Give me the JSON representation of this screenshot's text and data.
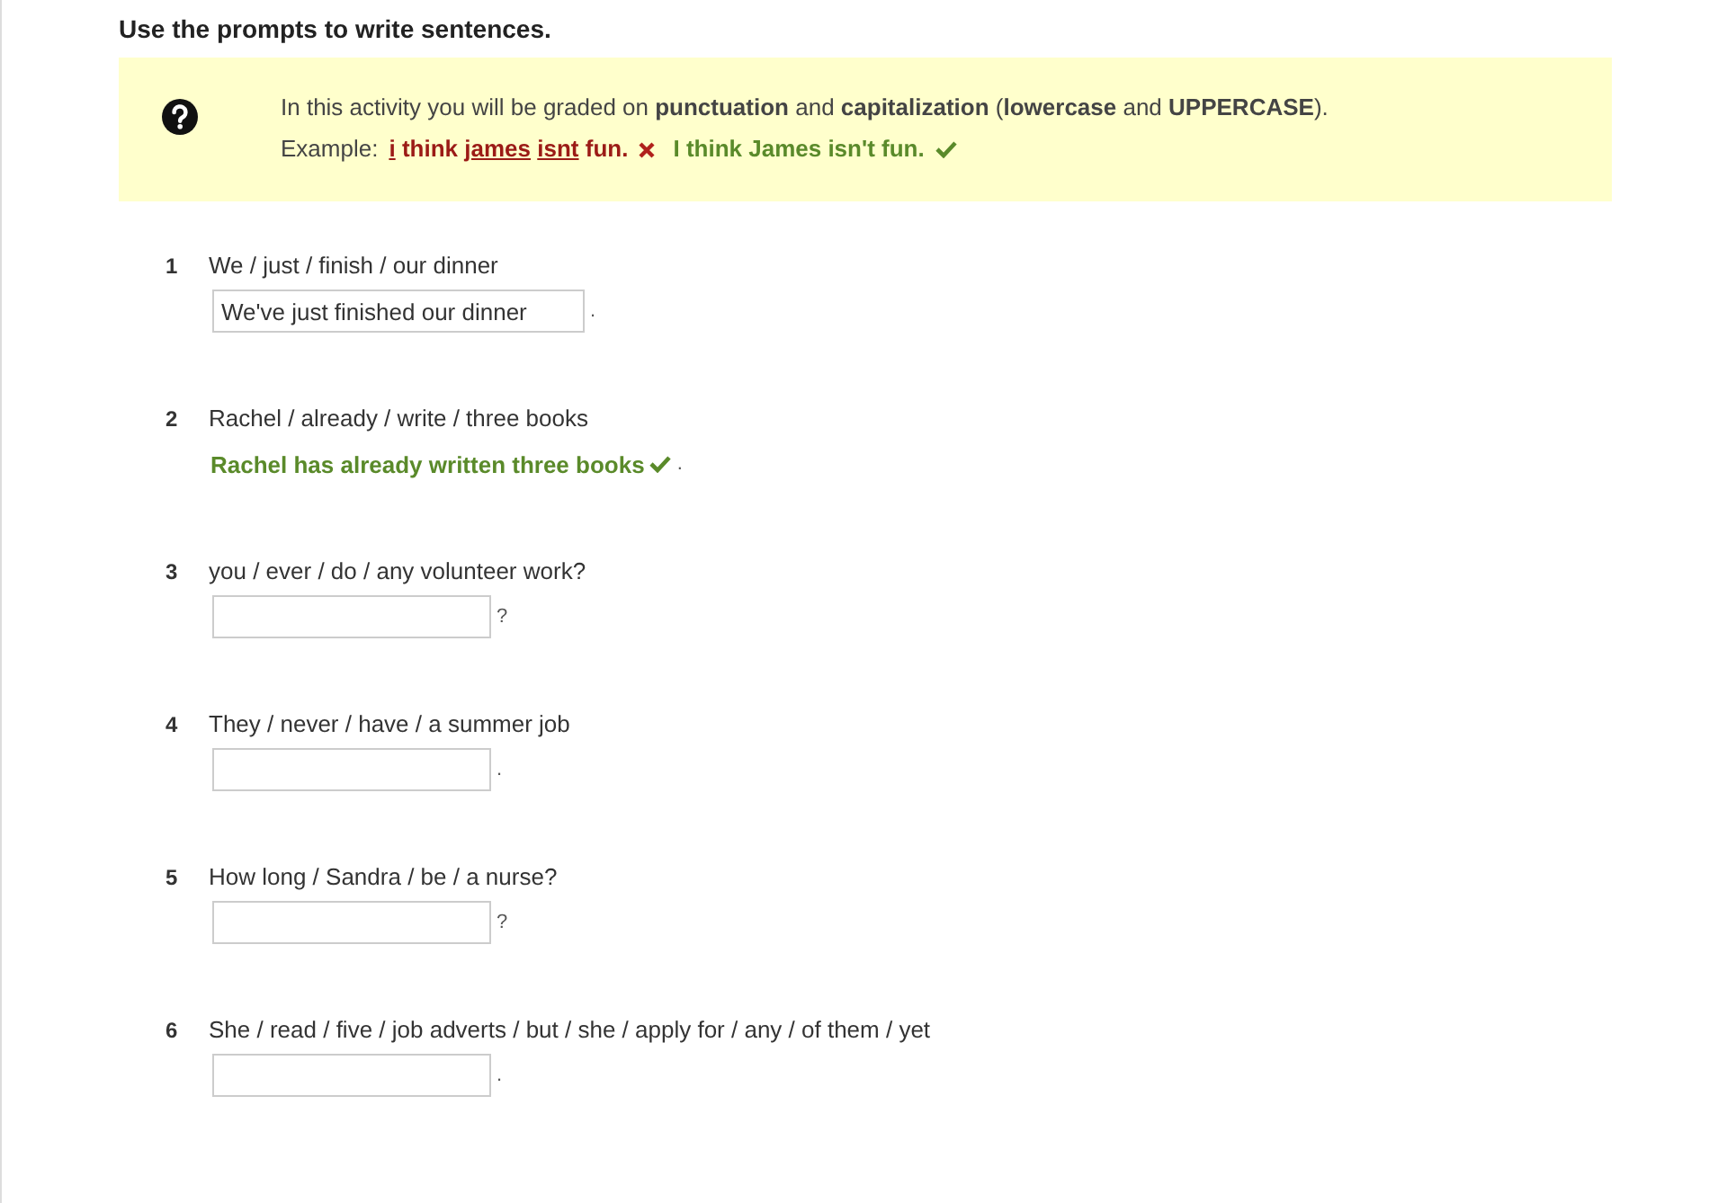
{
  "title": "Use the prompts to write sentences.",
  "info": {
    "text": "In this activity you will be graded on **punctuation** and **capitalization** (**lowercase** and **UPPERCASE**).",
    "example_label": "Example:",
    "wrong": [
      {
        "text": "i",
        "error": true
      },
      {
        "text": "think",
        "error": false
      },
      {
        "text": "james",
        "error": true
      },
      {
        "text": "isnt",
        "error": true
      },
      {
        "text": "fun.",
        "error": false
      }
    ],
    "right": "I think James isn't fun."
  },
  "items": [
    {
      "number": "1",
      "prompt": "We / just / finish / our dinner",
      "kind": "input",
      "value": "We've just finished our dinner",
      "end": "."
    },
    {
      "number": "2",
      "prompt": "Rachel / already / write / three books",
      "kind": "answered",
      "answer": "Rachel has already written three books",
      "correct": true,
      "end": "."
    },
    {
      "number": "3",
      "prompt": "you / ever / do / any volunteer work?",
      "kind": "input",
      "end": "?"
    },
    {
      "number": "4",
      "prompt": "They / never / have / a summer job",
      "kind": "input",
      "end": "."
    },
    {
      "number": "5",
      "prompt": "How long / Sandra / be / a nurse?",
      "kind": "input",
      "end": "?"
    },
    {
      "number": "6",
      "prompt": "She / read / five / job adverts / but / she / apply for / any / of them / yet",
      "kind": "input",
      "end": "."
    }
  ]
}
